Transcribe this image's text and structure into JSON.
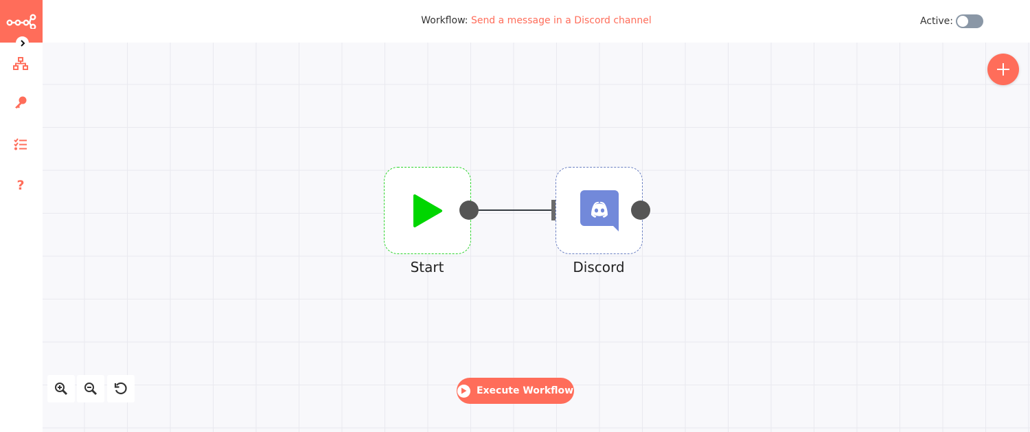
{
  "header": {
    "workflow_prefix": "Workflow:",
    "workflow_name": "Send a message in a Discord channel",
    "active_label": "Active:",
    "active": false
  },
  "sidebar": {
    "items": [
      {
        "icon": "sitemap-icon"
      },
      {
        "icon": "key-icon"
      },
      {
        "icon": "tasks-icon"
      },
      {
        "icon": "question-icon",
        "glyph": "?"
      }
    ]
  },
  "nodes": [
    {
      "label": "Start",
      "icon": "play-icon",
      "color": "#00d600"
    },
    {
      "label": "Discord",
      "icon": "discord-icon",
      "color": "#7289da"
    }
  ],
  "execute_button": {
    "label": "Execute Workflow"
  },
  "colors": {
    "accent": "#ff6d5a"
  }
}
